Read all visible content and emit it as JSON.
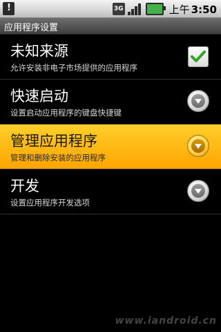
{
  "statusbar": {
    "network": "3G",
    "ampm": "上午",
    "time": "3:50",
    "icons": [
      "sd-card-warning-icon",
      "3g-icon",
      "signal-icon",
      "battery-icon"
    ]
  },
  "titlebar": {
    "title": "应用程序设置"
  },
  "items": [
    {
      "title": "未知来源",
      "subtitle": "允许安装非电子市场提供的应用程序",
      "control": "checkbox",
      "checked": true
    },
    {
      "title": "快速启动",
      "subtitle": "设置启动应用程序的键盘快捷键",
      "control": "dropdown"
    },
    {
      "title": "管理应用程序",
      "subtitle": "管理和删除安装的应用程序",
      "control": "dropdown",
      "selected": true
    },
    {
      "title": "开发",
      "subtitle": "设置应用程序开发选项",
      "control": "dropdown"
    }
  ],
  "watermark": "www.iandroid.cn",
  "colors": {
    "highlight": "#ffb400",
    "check": "#33a329"
  }
}
